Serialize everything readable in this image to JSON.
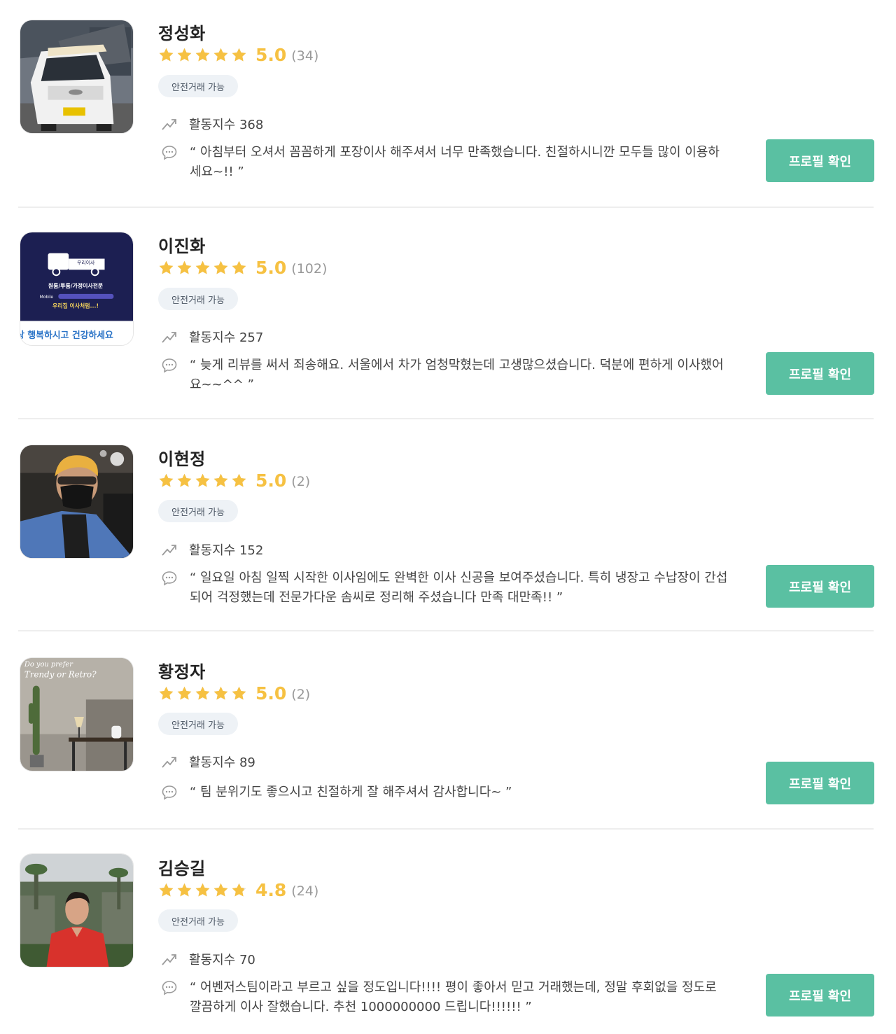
{
  "cards": [
    {
      "name": "정성화",
      "score": "5.0",
      "count": "(34)",
      "stars_filled": 5.0,
      "badge": "안전거래 가능",
      "activity": "활동지수 368",
      "review": "“ 아침부터 오셔서 꼼꼼하게 포장이사 해주셔서 너무 만족했습니다. 친절하시니깐 모두들 많이 이용하세요~!! ”",
      "button": "프로필 확인"
    },
    {
      "name": "이진화",
      "score": "5.0",
      "count": "(102)",
      "stars_filled": 5.0,
      "badge": "안전거래 가능",
      "activity": "활동지수 257",
      "review": "“ 늦게 리뷰를 써서 죄송해요. 서울에서 차가 엄청막혔는데 고생많으셨습니다. 덕분에 편하게 이사했어요~~^^ ”",
      "button": "프로필 확인",
      "avatar_text": {
        "company": "우리이사",
        "service": "원룸/투룸/가정이사전문",
        "mobile": "Mobile",
        "slogan": "우리집 이사처럼...!",
        "banner": "상 행복하시고 건강하세요"
      }
    },
    {
      "name": "이현정",
      "score": "5.0",
      "count": "(2)",
      "stars_filled": 5.0,
      "badge": "안전거래 가능",
      "activity": "활동지수 152",
      "review": "“ 일요일 아침 일찍 시작한 이사임에도 완벽한 이사 신공을 보여주셨습니다. 특히 냉장고 수납장이 간섭되어 걱정했는데 전문가다운 솜씨로 정리해 주셨습니다 만족 대만족!! ”",
      "button": "프로필 확인"
    },
    {
      "name": "황정자",
      "score": "5.0",
      "count": "(2)",
      "stars_filled": 5.0,
      "badge": "안전거래 가능",
      "activity": "활동지수 89",
      "review": "“ 팀 분위기도 좋으시고 친절하게 잘 해주셔서 감사합니다~ ”",
      "button": "프로필 확인",
      "avatar_text": {
        "line1": "Do you prefer",
        "line2": "Trendy or Retro?"
      }
    },
    {
      "name": "김승길",
      "score": "4.8",
      "count": "(24)",
      "stars_filled": 4.8,
      "badge": "안전거래 가능",
      "activity": "활동지수 70",
      "review": "“ 어벤저스팀이라고 부르고 싶을 정도입니다!!!! 평이 좋아서 믿고 거래했는데, 정말 후회없을 정도로 깔끔하게 이사 잘했습니다. 추천 1000000000 드립니다!!!!!! ”",
      "button": "프로필 확인"
    }
  ],
  "colors": {
    "star": "#f6c142",
    "star_empty": "#dcdcdc",
    "button": "#5ac0a2",
    "badge_bg": "#eef2f6"
  },
  "icons": {
    "activity": "trending-up-icon",
    "review": "speech-bubble-icon",
    "rating": "star-icon"
  }
}
